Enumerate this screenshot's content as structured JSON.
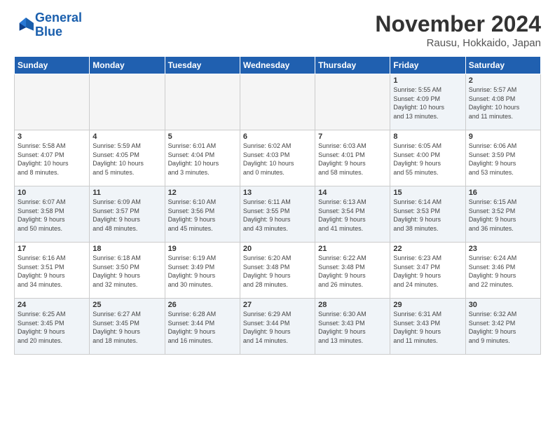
{
  "header": {
    "logo_line1": "General",
    "logo_line2": "Blue",
    "title": "November 2024",
    "subtitle": "Rausu, Hokkaido, Japan"
  },
  "weekdays": [
    "Sunday",
    "Monday",
    "Tuesday",
    "Wednesday",
    "Thursday",
    "Friday",
    "Saturday"
  ],
  "weeks": [
    [
      {
        "day": "",
        "info": ""
      },
      {
        "day": "",
        "info": ""
      },
      {
        "day": "",
        "info": ""
      },
      {
        "day": "",
        "info": ""
      },
      {
        "day": "",
        "info": ""
      },
      {
        "day": "1",
        "info": "Sunrise: 5:55 AM\nSunset: 4:09 PM\nDaylight: 10 hours\nand 13 minutes."
      },
      {
        "day": "2",
        "info": "Sunrise: 5:57 AM\nSunset: 4:08 PM\nDaylight: 10 hours\nand 11 minutes."
      }
    ],
    [
      {
        "day": "3",
        "info": "Sunrise: 5:58 AM\nSunset: 4:07 PM\nDaylight: 10 hours\nand 8 minutes."
      },
      {
        "day": "4",
        "info": "Sunrise: 5:59 AM\nSunset: 4:05 PM\nDaylight: 10 hours\nand 5 minutes."
      },
      {
        "day": "5",
        "info": "Sunrise: 6:01 AM\nSunset: 4:04 PM\nDaylight: 10 hours\nand 3 minutes."
      },
      {
        "day": "6",
        "info": "Sunrise: 6:02 AM\nSunset: 4:03 PM\nDaylight: 10 hours\nand 0 minutes."
      },
      {
        "day": "7",
        "info": "Sunrise: 6:03 AM\nSunset: 4:01 PM\nDaylight: 9 hours\nand 58 minutes."
      },
      {
        "day": "8",
        "info": "Sunrise: 6:05 AM\nSunset: 4:00 PM\nDaylight: 9 hours\nand 55 minutes."
      },
      {
        "day": "9",
        "info": "Sunrise: 6:06 AM\nSunset: 3:59 PM\nDaylight: 9 hours\nand 53 minutes."
      }
    ],
    [
      {
        "day": "10",
        "info": "Sunrise: 6:07 AM\nSunset: 3:58 PM\nDaylight: 9 hours\nand 50 minutes."
      },
      {
        "day": "11",
        "info": "Sunrise: 6:09 AM\nSunset: 3:57 PM\nDaylight: 9 hours\nand 48 minutes."
      },
      {
        "day": "12",
        "info": "Sunrise: 6:10 AM\nSunset: 3:56 PM\nDaylight: 9 hours\nand 45 minutes."
      },
      {
        "day": "13",
        "info": "Sunrise: 6:11 AM\nSunset: 3:55 PM\nDaylight: 9 hours\nand 43 minutes."
      },
      {
        "day": "14",
        "info": "Sunrise: 6:13 AM\nSunset: 3:54 PM\nDaylight: 9 hours\nand 41 minutes."
      },
      {
        "day": "15",
        "info": "Sunrise: 6:14 AM\nSunset: 3:53 PM\nDaylight: 9 hours\nand 38 minutes."
      },
      {
        "day": "16",
        "info": "Sunrise: 6:15 AM\nSunset: 3:52 PM\nDaylight: 9 hours\nand 36 minutes."
      }
    ],
    [
      {
        "day": "17",
        "info": "Sunrise: 6:16 AM\nSunset: 3:51 PM\nDaylight: 9 hours\nand 34 minutes."
      },
      {
        "day": "18",
        "info": "Sunrise: 6:18 AM\nSunset: 3:50 PM\nDaylight: 9 hours\nand 32 minutes."
      },
      {
        "day": "19",
        "info": "Sunrise: 6:19 AM\nSunset: 3:49 PM\nDaylight: 9 hours\nand 30 minutes."
      },
      {
        "day": "20",
        "info": "Sunrise: 6:20 AM\nSunset: 3:48 PM\nDaylight: 9 hours\nand 28 minutes."
      },
      {
        "day": "21",
        "info": "Sunrise: 6:22 AM\nSunset: 3:48 PM\nDaylight: 9 hours\nand 26 minutes."
      },
      {
        "day": "22",
        "info": "Sunrise: 6:23 AM\nSunset: 3:47 PM\nDaylight: 9 hours\nand 24 minutes."
      },
      {
        "day": "23",
        "info": "Sunrise: 6:24 AM\nSunset: 3:46 PM\nDaylight: 9 hours\nand 22 minutes."
      }
    ],
    [
      {
        "day": "24",
        "info": "Sunrise: 6:25 AM\nSunset: 3:45 PM\nDaylight: 9 hours\nand 20 minutes."
      },
      {
        "day": "25",
        "info": "Sunrise: 6:27 AM\nSunset: 3:45 PM\nDaylight: 9 hours\nand 18 minutes."
      },
      {
        "day": "26",
        "info": "Sunrise: 6:28 AM\nSunset: 3:44 PM\nDaylight: 9 hours\nand 16 minutes."
      },
      {
        "day": "27",
        "info": "Sunrise: 6:29 AM\nSunset: 3:44 PM\nDaylight: 9 hours\nand 14 minutes."
      },
      {
        "day": "28",
        "info": "Sunrise: 6:30 AM\nSunset: 3:43 PM\nDaylight: 9 hours\nand 13 minutes."
      },
      {
        "day": "29",
        "info": "Sunrise: 6:31 AM\nSunset: 3:43 PM\nDaylight: 9 hours\nand 11 minutes."
      },
      {
        "day": "30",
        "info": "Sunrise: 6:32 AM\nSunset: 3:42 PM\nDaylight: 9 hours\nand 9 minutes."
      }
    ]
  ]
}
